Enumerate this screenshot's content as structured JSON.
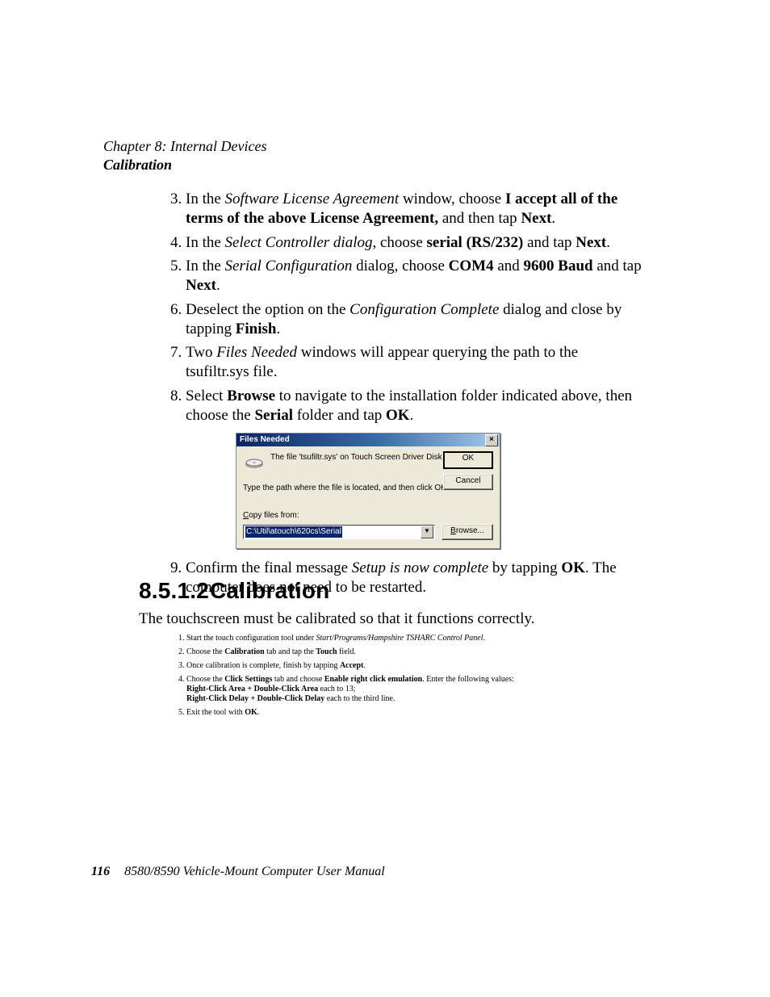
{
  "header": {
    "chapter": "Chapter 8: Internal Devices",
    "section": "Calibration"
  },
  "steps_a": {
    "s3": {
      "pre": "In the ",
      "i1": "Software License Agreement",
      "mid1": " window, choose ",
      "b1": "I accept all of the terms of the above License Agreement,",
      "mid2": " and then tap ",
      "b2": "Next",
      "end": "."
    },
    "s4": {
      "pre": "In the ",
      "i1": "Select Controller dialog",
      "mid1": ", choose ",
      "b1": "serial (RS/232)",
      "mid2": " and tap ",
      "b2": "Next",
      "end": "."
    },
    "s5": {
      "pre": "In the ",
      "i1": "Serial Configuration",
      "mid1": " dialog, choose ",
      "b1": "COM4",
      "mid2": " and ",
      "b2": "9600 Baud",
      "mid3": " and tap ",
      "b3": "Next",
      "end": "."
    },
    "s6": {
      "pre": "Deselect the option on the ",
      "i1": "Configuration Complete",
      "mid1": " dialog and close by tapping ",
      "b1": "Finish",
      "end": "."
    },
    "s7": {
      "pre": "Two ",
      "i1": "Files Needed",
      "mid1": " windows will appear querying the path to the tsufiltr.sys file."
    },
    "s8": {
      "pre": "Select ",
      "b1": "Browse",
      "mid1": " to navigate to the installation folder indicated above, then choose the ",
      "b2": "Serial",
      "mid2": " folder and tap ",
      "b3": "OK",
      "end": "."
    },
    "s9": {
      "pre": "Confirm the final message ",
      "i1": "Setup is now complete",
      "mid1": " by tapping ",
      "b1": "OK",
      "end": ". The computer does not need to be restarted."
    }
  },
  "dialog": {
    "title": "Files Needed",
    "msg": "The file 'tsufiltr.sys' on Touch Screen Driver Disk is needed.",
    "sub": "Type the path where the file is located, and then click OK.",
    "label_pre": "C",
    "label_post": "opy files from:",
    "path": "C:\\Util\\atouch\\620cs\\Serial",
    "ok": "OK",
    "cancel": "Cancel",
    "browse_pre": "B",
    "browse_post": "rowse..."
  },
  "section2": {
    "num": "8.5.1.2",
    "title": "Calibration",
    "intro": "The touchscreen must be calibrated so that it functions correctly.",
    "s1": {
      "pre": "Start the touch configuration tool under ",
      "i1": "Start/Programs/Hampshire TSHARC Control Panel",
      "end": "."
    },
    "s2": {
      "pre": "Choose the ",
      "b1": "Calibration",
      "mid1": " tab and tap the ",
      "b2": "Touch",
      "end": " field."
    },
    "s3": {
      "pre": "Once calibration is complete, finish by tapping ",
      "b1": "Accept",
      "end": "."
    },
    "s4": {
      "pre": "Choose the ",
      "b1": "Click Settings",
      "mid1": " tab and choose ",
      "b2": "Enable right click emulation",
      "mid2": ". Enter the following values:",
      "line2a": "Right-Click Area + Double-Click Area",
      "line2b": " each to 13;",
      "line3a": "Right-Click Delay + Double-Click Delay",
      "line3b": " each to the third line."
    },
    "s5": {
      "pre": "Exit the tool with ",
      "b1": "OK",
      "end": "."
    }
  },
  "footer": {
    "page": "116",
    "title": "8580/8590 Vehicle-Mount Computer User Manual"
  }
}
